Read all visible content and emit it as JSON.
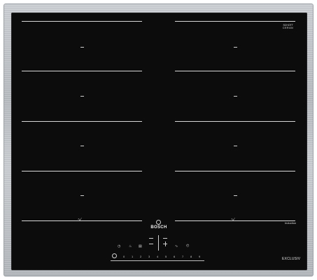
{
  "appliance": {
    "brand": "BOSCH",
    "series": "EXCLUSIV",
    "technology": "Induction",
    "glass_maker_line1": "SCHOTT",
    "glass_maker_line2": "CERAN"
  },
  "controls": {
    "power_icon": "power-icon",
    "slider_values": [
      "0",
      "1",
      "2",
      "3",
      "4",
      "5",
      "6",
      "7",
      "8",
      "9"
    ],
    "left_symbols": [
      "timer-icon",
      "boost-icon",
      "childlock-icon"
    ],
    "center_symbols": [
      "minus-icon",
      "plus-icon"
    ],
    "right_symbols": [
      "flex-zone-icon",
      "clock-icon"
    ]
  },
  "colors": {
    "glass": "#0c0c0c",
    "frame": "#b8bdc2",
    "markings": "#d8d8d8"
  }
}
